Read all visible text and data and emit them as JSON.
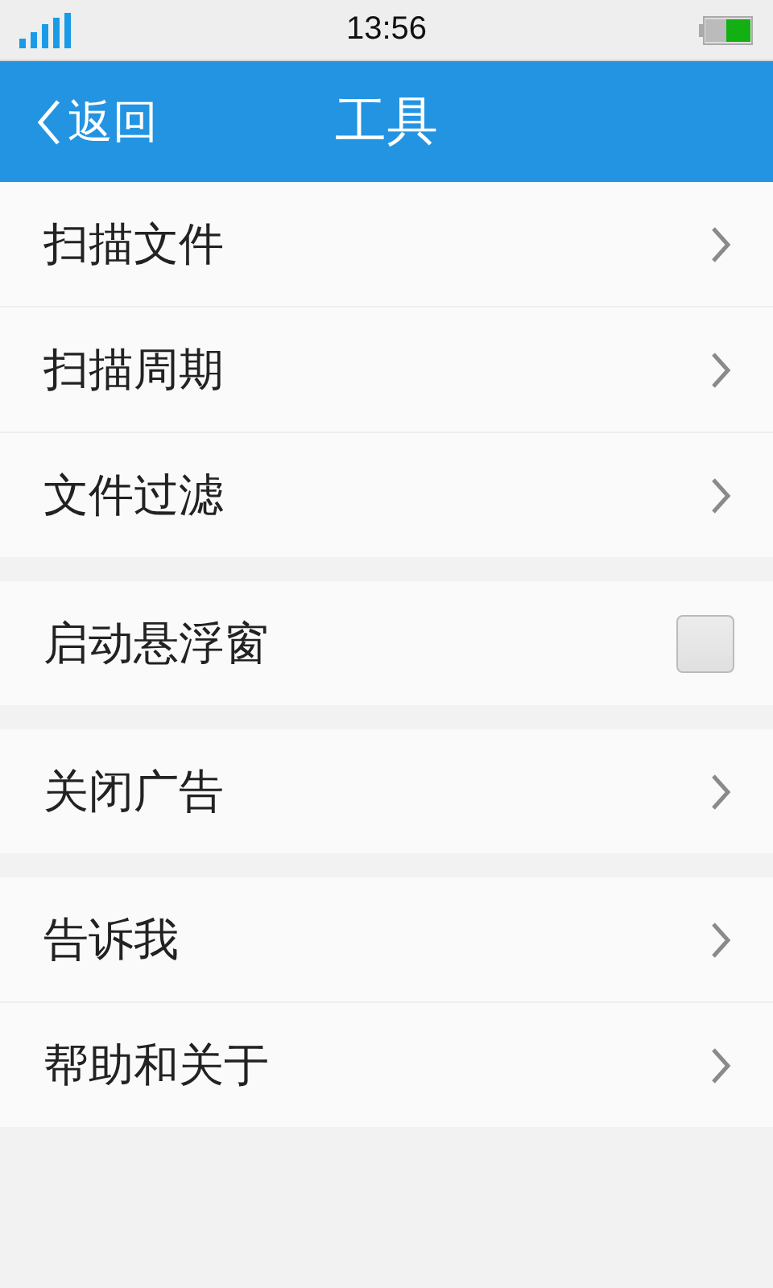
{
  "status_bar": {
    "time": "13:56"
  },
  "header": {
    "back": "返回",
    "title": "工具"
  },
  "groups": [
    {
      "items": [
        {
          "label": "扫描文件",
          "kind": "link"
        },
        {
          "label": "扫描周期",
          "kind": "link"
        },
        {
          "label": "文件过滤",
          "kind": "link"
        }
      ]
    },
    {
      "items": [
        {
          "label": "启动悬浮窗",
          "kind": "checkbox",
          "checked": false
        }
      ]
    },
    {
      "items": [
        {
          "label": "关闭广告",
          "kind": "link"
        }
      ]
    },
    {
      "items": [
        {
          "label": "告诉我",
          "kind": "link"
        },
        {
          "label": "帮助和关于",
          "kind": "link"
        }
      ]
    }
  ]
}
